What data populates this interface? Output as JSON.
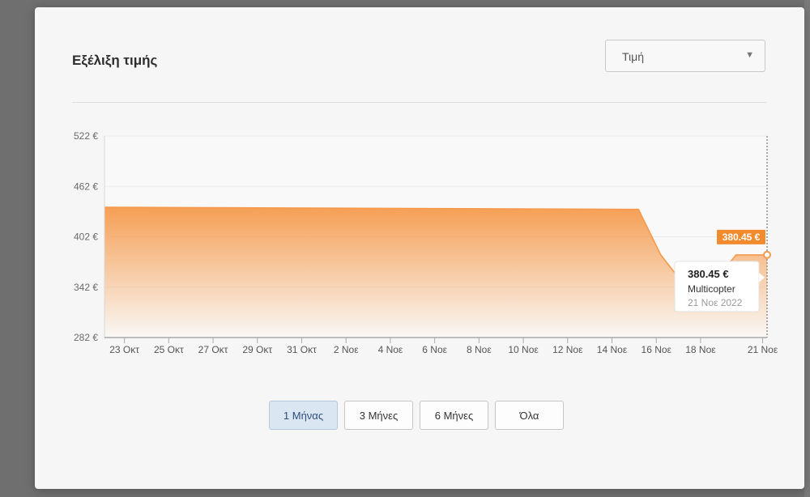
{
  "modal": {
    "title": "Εξέλιξη τιμής",
    "metric_select": {
      "value": "Τιμή",
      "caret": "▼"
    }
  },
  "range_buttons": [
    {
      "label": "1 Μήνας",
      "active": true
    },
    {
      "label": "3 Μήνες",
      "active": false
    },
    {
      "label": "6 Μήνες",
      "active": false
    },
    {
      "label": "Όλα",
      "active": false
    }
  ],
  "tooltip": {
    "price": "380.45 €",
    "store": "Multicopter",
    "date": "21 Νοε 2022"
  },
  "current_badge": "380.45 €",
  "colors": {
    "series": "#f59a4c",
    "badge": "#f28a2e",
    "active_button": "#dbe6f3"
  },
  "chart_data": {
    "type": "area",
    "ylim": [
      282,
      522
    ],
    "y_ticks": [
      "282 €",
      "342 €",
      "402 €",
      "462 €",
      "522 €"
    ],
    "y_tick_values": [
      282,
      342,
      402,
      462,
      522
    ],
    "x_tick_labels": [
      "23 Οκτ",
      "25 Οκτ",
      "27 Οκτ",
      "29 Οκτ",
      "31 Οκτ",
      "2 Νοε",
      "4 Νοε",
      "6 Νοε",
      "8 Νοε",
      "10 Νοε",
      "12 Νοε",
      "14 Νοε",
      "16 Νοε",
      "18 Νοε",
      "21 Νοε"
    ],
    "x_tick_days": [
      0,
      2,
      4,
      6,
      8,
      10,
      12,
      14,
      16,
      18,
      20,
      22,
      24,
      26,
      28.8
    ],
    "x_range_days": [
      -0.9,
      29
    ],
    "series": [
      {
        "x_days": [
          -0.9,
          23.2,
          24.2,
          25.1,
          26.0,
          26.5,
          27.6,
          29.0
        ],
        "values": [
          437.2,
          434.6,
          380.5,
          350.0,
          342.0,
          345.0,
          380.45,
          380.45
        ]
      }
    ],
    "grid": true
  }
}
